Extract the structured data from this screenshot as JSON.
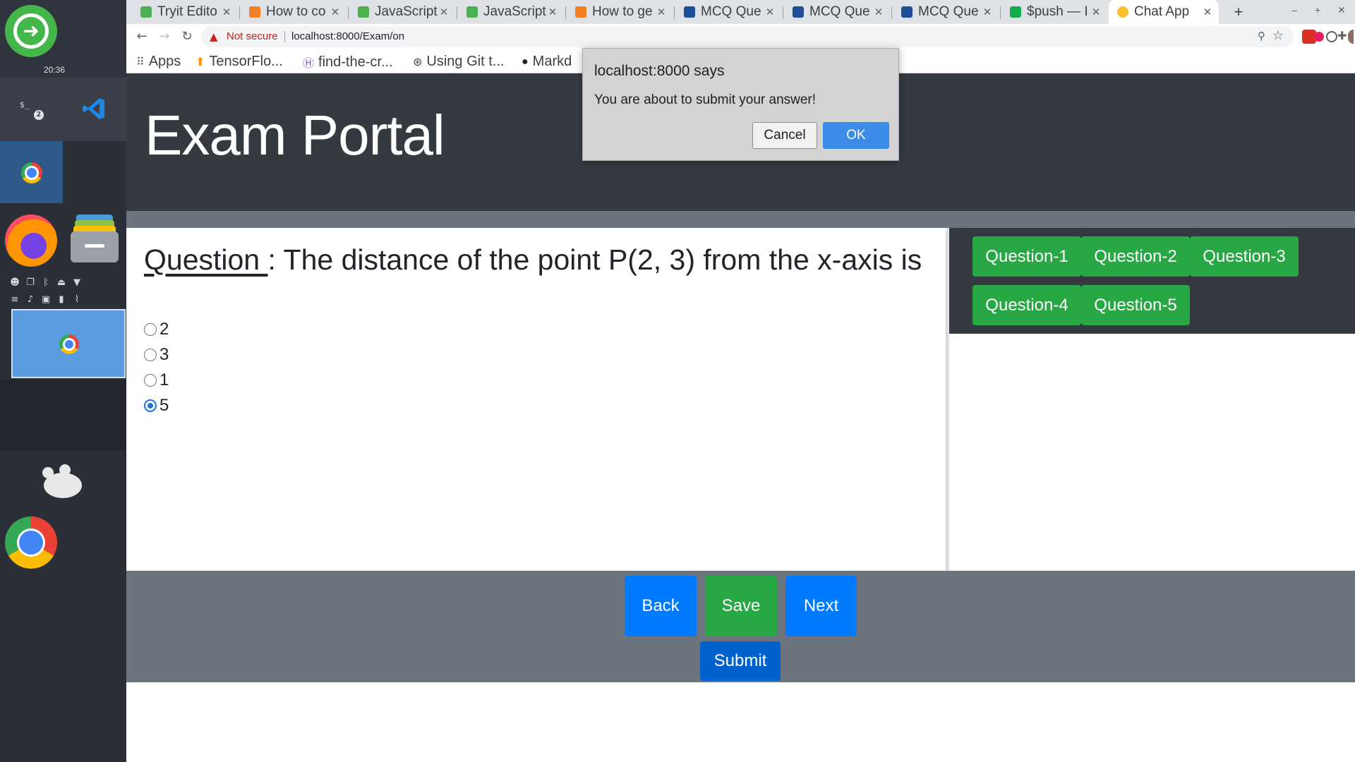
{
  "dock": {
    "clock": "20:36",
    "terminal_prompt": "$_",
    "terminal_badge": "2",
    "icons": [
      "launcher-icon",
      "terminal-icon",
      "vscode-icon",
      "chrome-icon",
      "firefox-icon",
      "files-icon",
      "mouse-icon",
      "chrome-icon"
    ]
  },
  "browser": {
    "tabs": [
      {
        "title": "Tryit Edito",
        "favicon_color": "#4caf50",
        "active": false
      },
      {
        "title": "How to co",
        "favicon_color": "#f48024",
        "active": false
      },
      {
        "title": "JavaScript",
        "favicon_color": "#4caf50",
        "active": false
      },
      {
        "title": "JavaScript",
        "favicon_color": "#4caf50",
        "active": false
      },
      {
        "title": "How to ge",
        "favicon_color": "#f48024",
        "active": false
      },
      {
        "title": "MCQ Que",
        "favicon_color": "#1f4e96",
        "active": false
      },
      {
        "title": "MCQ Que",
        "favicon_color": "#1f4e96",
        "active": false
      },
      {
        "title": "MCQ Que",
        "favicon_color": "#1f4e96",
        "active": false
      },
      {
        "title": "$push — I",
        "favicon_color": "#13aa52",
        "active": false
      },
      {
        "title": "Chat App",
        "favicon_color": "#fbc02d",
        "active": true
      }
    ],
    "new_tab": "+",
    "window_controls": {
      "minimize": "–",
      "maximize": "+",
      "close": "✕"
    },
    "security_label": "Not secure",
    "url": "localhost:8000/Exam/on",
    "bookmarks": [
      {
        "label": "Apps",
        "icon": "apps-grid-icon"
      },
      {
        "label": "TensorFlo...",
        "icon": "tensorflow-icon"
      },
      {
        "label": "find-the-cr...",
        "icon": "h-icon"
      },
      {
        "label": "Using Git t...",
        "icon": "git-icon"
      },
      {
        "label": "Markd",
        "icon": "github-icon"
      }
    ]
  },
  "page": {
    "brand": "Exam Portal",
    "question_label": "Question ",
    "question_text": ": The distance of the point P(2, 3) from the x-axis is",
    "options": [
      {
        "label": "2",
        "checked": false
      },
      {
        "label": "3",
        "checked": false
      },
      {
        "label": "1",
        "checked": false
      },
      {
        "label": "5",
        "checked": true
      }
    ],
    "question_buttons": [
      "Question-1",
      "Question-2",
      "Question-3",
      "Question-4",
      "Question-5"
    ],
    "footer": {
      "back": "Back",
      "save": "Save",
      "next": "Next",
      "submit": "Submit"
    }
  },
  "dialog": {
    "title": "localhost:8000 says",
    "message": "You are about to submit your answer!",
    "cancel": "Cancel",
    "ok": "OK"
  },
  "colors": {
    "header_dark": "#343a40",
    "strip_gray": "#6c757d",
    "btn_green": "#28a745",
    "btn_blue": "#007bff",
    "dialog_ok": "#3c8ce7"
  }
}
